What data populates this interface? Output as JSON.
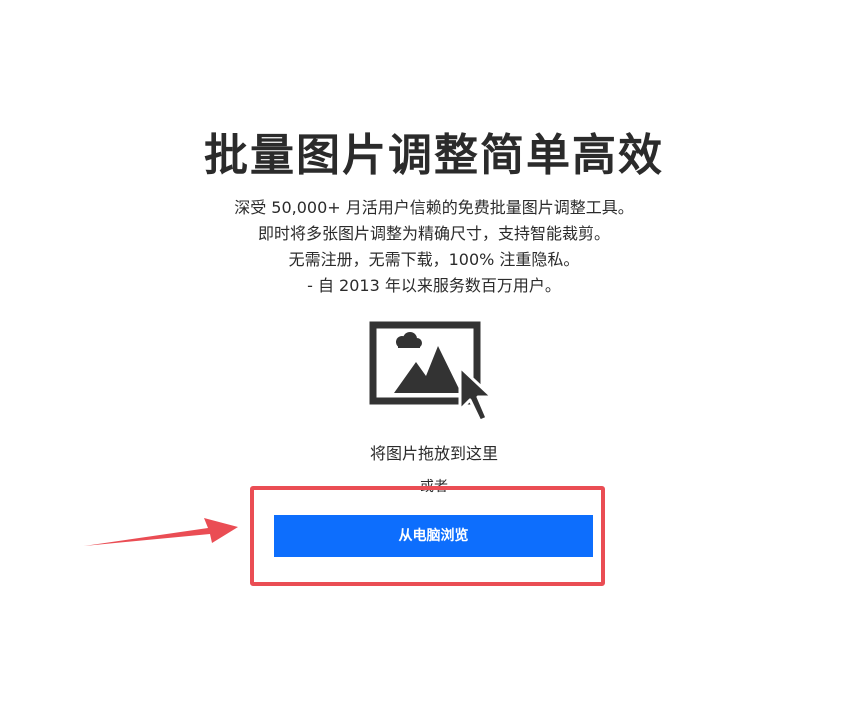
{
  "hero": {
    "title": "批量图片调整简单高效",
    "description_lines": [
      "深受 50,000+ 月活用户信赖的免费批量图片调整工具。",
      "即时将多张图片调整为精确尺寸，支持智能裁剪。",
      "无需注册，无需下载，100% 注重隐私。",
      "- 自 2013 年以来服务数百万用户。"
    ]
  },
  "upload": {
    "icon": "image-upload-icon",
    "drop_text": "将图片拖放到这里",
    "or_text": "或者",
    "browse_label": "从电脑浏览"
  },
  "annotation": {
    "highlight_color": "#ea4d54",
    "arrow_color": "#ea4d54"
  },
  "colors": {
    "button": "#0d6efd",
    "text": "#2b2b2b"
  }
}
